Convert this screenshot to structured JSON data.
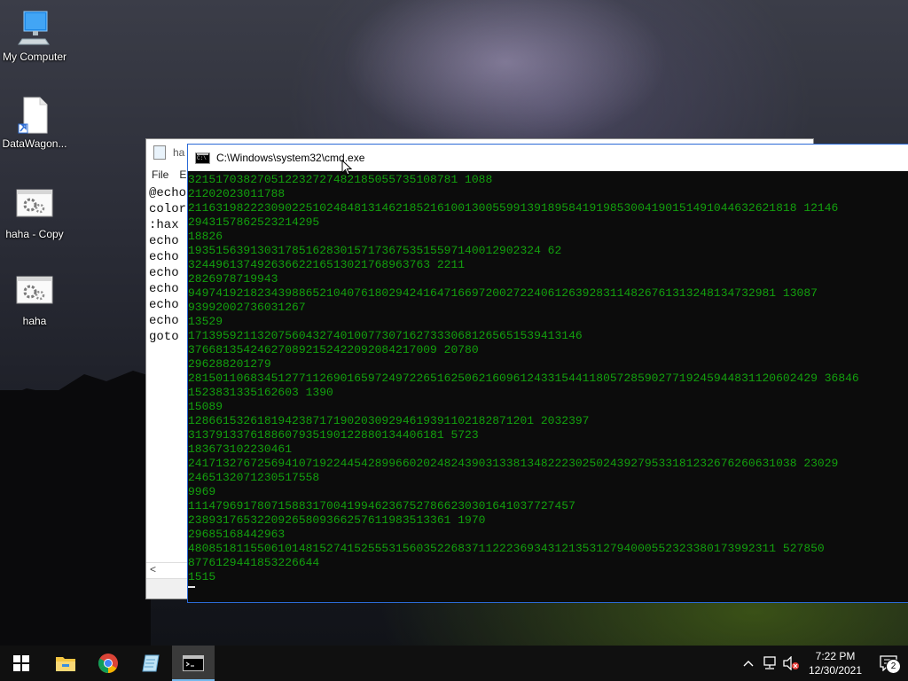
{
  "desktop": {
    "icons": [
      {
        "label": "My Computer",
        "icon": "computer-icon"
      },
      {
        "label": "DataWagon...",
        "icon": "shortcut-file-icon"
      },
      {
        "label": "haha - Copy",
        "icon": "batch-file-icon"
      },
      {
        "label": "haha",
        "icon": "batch-file-icon"
      }
    ]
  },
  "notepad": {
    "title": "ha",
    "menu": [
      "File",
      "E"
    ],
    "lines": [
      "@echo",
      "color",
      ":hax",
      "echo",
      "echo",
      "echo",
      "echo",
      "echo",
      "echo",
      "goto"
    ],
    "scroll_arrow": "<"
  },
  "cmd": {
    "title": "C:\\Windows\\system32\\cmd.exe",
    "lines": [
      "321517038270512232727482185055735108781 1088",
      "21202023011788",
      "2116319822230902251024848131462185216100130055991391895841919853004190151491044632621818 12146",
      "2943157862523214295",
      "18826",
      "193515639130317851628301571736753515597140012902324 62",
      "32449613749263662216513021768963763 2211",
      "2826978719943",
      "9497419218234398865210407618029424164716697200272240612639283114826761313248134732981 13087",
      "93992002736031267",
      "13529",
      "171395921132075604327401007730716273330681265651539413146",
      "376681354246270892152422092084217009 20780",
      "296288201279",
      "2815011068345127711269016597249722651625062160961243315441180572859027719245944831120602429 36846",
      "1523831335162603 1390",
      "15089",
      "12866153261819423871719020309294619391102182871201 2032397",
      "3137913376188607935190122880134406181 5723",
      "183673102230461",
      "2417132767256941071922445428996602024824390313381348222302502439279533181232676260631038 23029",
      "2465132071230517558",
      "9969",
      "11147969178071588317004199462367527866230301641037727457",
      "23893176532209265809366257611983513361 1970",
      "29685168442963",
      "4808518115506101481527415255531560352268371122236934312135312794000552323380173992311 527850",
      "8776129441853226644",
      "1515"
    ]
  },
  "taskbar": {
    "apps": [
      {
        "name": "start",
        "icon": "windows-start-icon"
      },
      {
        "name": "file-explorer",
        "icon": "folder-icon"
      },
      {
        "name": "chrome",
        "icon": "chrome-icon"
      },
      {
        "name": "notepad",
        "icon": "notepad-icon"
      },
      {
        "name": "cmd",
        "icon": "command-prompt-icon",
        "active": true
      }
    ],
    "tray": {
      "time": "7:22 PM",
      "date": "12/30/2021",
      "notifications_count": "2"
    }
  },
  "colors": {
    "console_text": "#13a10e",
    "console_bg": "#0c0c0c",
    "taskbar_bg": "#101010",
    "active_accent": "#76b9ed"
  }
}
